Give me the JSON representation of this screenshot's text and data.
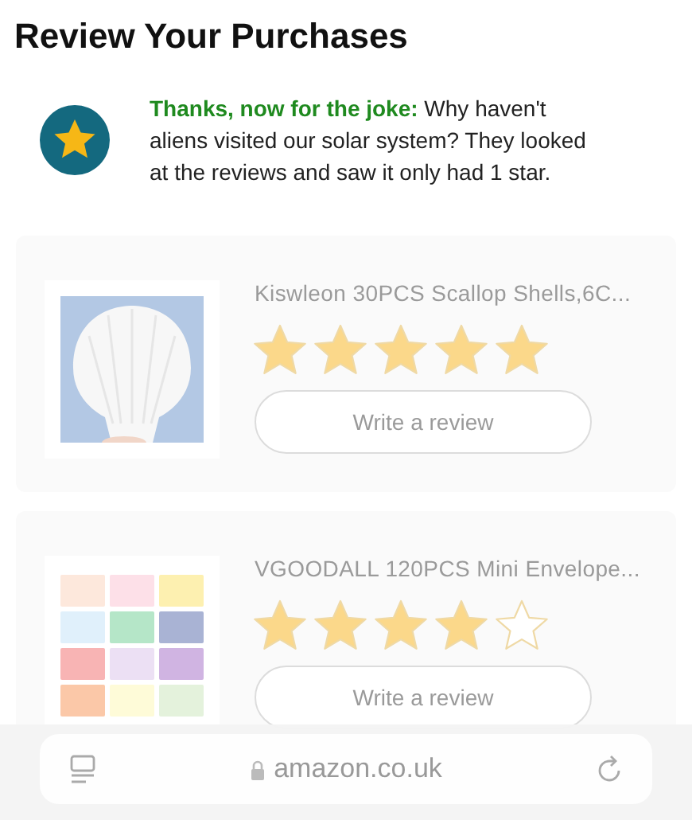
{
  "title": "Review Your Purchases",
  "joke": "**Thanks, now for the joke:** Why haven't aliens visited our solar system? They looked at the reviews and saw it only had 1 star.",
  "products": [
    {
      "name": "Kiswleon 30PCS Scallop Shells,6C...",
      "stars": 5,
      "button": "Write a review"
    },
    {
      "name": "VGOODALL 120PCS Mini Envelope...",
      "stars": 4,
      "button": "Write a review"
    }
  ],
  "browser_bar": {
    "url": "amazon.co.uk"
  }
}
